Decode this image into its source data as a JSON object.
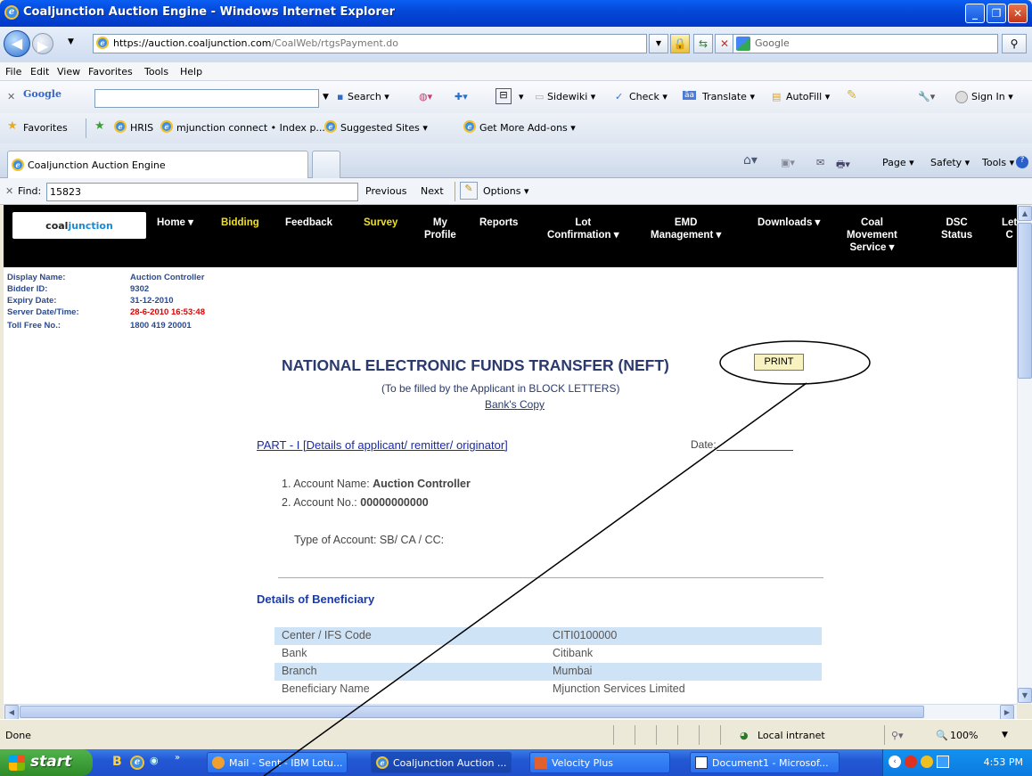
{
  "window": {
    "title": "Coaljunction Auction Engine - Windows Internet Explorer"
  },
  "address": {
    "url_main": "https://auction.coaljunction.com",
    "url_path": "/CoalWeb/rtgsPayment.do",
    "search_placeholder": "Google"
  },
  "menu": [
    "File",
    "Edit",
    "View",
    "Favorites",
    "Tools",
    "Help"
  ],
  "google_toolbar": {
    "logo": "Google",
    "search": "Search ▾",
    "sidewiki": "Sidewiki ▾",
    "check": "Check ▾",
    "translate": "Translate ▾",
    "autofill": "AutoFill ▾",
    "signin": "Sign In ▾"
  },
  "favorites": {
    "label": "Favorites",
    "items": [
      "HRIS",
      "mjunction connect • Index p...",
      "Suggested Sites ▾",
      "Get More Add-ons ▾"
    ]
  },
  "tabs": {
    "active": "Coaljunction Auction Engine",
    "commands": [
      "Page ▾",
      "Safety ▾",
      "Tools ▾"
    ]
  },
  "find": {
    "label": "Find:",
    "value": "15823",
    "previous": "Previous",
    "next": "Next",
    "options": "Options ▾"
  },
  "site": {
    "logo_a": "coal",
    "logo_b": "junction",
    "nav": [
      {
        "label": "Home ▾",
        "highlight": false
      },
      {
        "label": "Bidding",
        "highlight": true
      },
      {
        "label": "Feedback",
        "highlight": false
      },
      {
        "label": "Survey",
        "highlight": true
      },
      {
        "label": "My\nProfile",
        "highlight": false
      },
      {
        "label": "Reports",
        "highlight": false
      },
      {
        "label": "Lot\nConfirmation ▾",
        "highlight": false
      },
      {
        "label": "EMD\nManagement ▾",
        "highlight": false
      },
      {
        "label": "Downloads ▾",
        "highlight": false
      },
      {
        "label": "Coal\nMovement\nService ▾",
        "highlight": false
      },
      {
        "label": "DSC\nStatus",
        "highlight": false
      },
      {
        "label": "Let\nC",
        "highlight": false
      }
    ],
    "info": [
      {
        "label": "Display Name:",
        "value": "Auction Controller",
        "red": false
      },
      {
        "label": "Bidder ID:",
        "value": "9302",
        "red": false
      },
      {
        "label": "Expiry Date:",
        "value": "31-12-2010",
        "red": false
      },
      {
        "label": "Server Date/Time:",
        "value": "28-6-2010 16:53:48",
        "red": true
      },
      {
        "label": "Toll Free No.:",
        "value": "1800 419 20001",
        "red": false
      }
    ]
  },
  "form": {
    "heading": "NATIONAL ELECTRONIC FUNDS TRANSFER (NEFT)",
    "print": "PRINT",
    "subtitle": "(To be filled by the Applicant in BLOCK LETTERS)",
    "copy": "Bank's Copy",
    "part1": "PART - I [Details of applicant/ remitter/ originator]",
    "date_label": "Date:",
    "acc_name_label": "1. Account Name: ",
    "acc_name": "Auction Controller",
    "acc_no_label": "2. Account No.: ",
    "acc_no": "00000000000",
    "acc_type": "Type of Account: SB/ CA / CC:",
    "beneficiary_title": "Details of Beneficiary",
    "rows": [
      {
        "key": "Center / IFS Code",
        "value": "CITI0100000"
      },
      {
        "key": "Bank",
        "value": "Citibank"
      },
      {
        "key": "Branch",
        "value": "Mumbai"
      },
      {
        "key": "Beneficiary Name",
        "value": "Mjunction Services Limited"
      }
    ]
  },
  "status": {
    "text": "Done",
    "zone": "Local intranet",
    "zoom": "100%"
  },
  "taskbar": {
    "start": "start",
    "tasks": [
      "Mail - Sent - IBM Lotu...",
      "Coaljunction Auction ...",
      "Velocity Plus",
      "Document1 - Microsof..."
    ],
    "clock": "4:53 PM"
  }
}
